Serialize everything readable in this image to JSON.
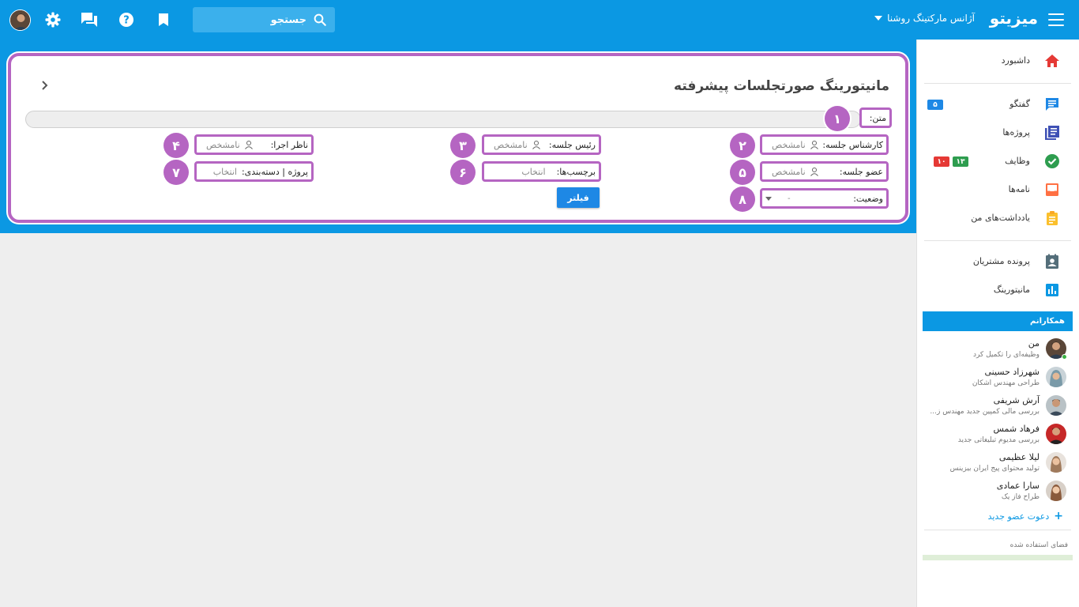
{
  "topbar": {
    "brand": "میزیتو",
    "org": "آژانس مارکتینگ روشنا",
    "search_placeholder": "جستجو",
    "icons": [
      "menu-icon",
      "search-icon",
      "bookmark-icon",
      "help-icon",
      "chat-icon",
      "settings-icon",
      "avatar"
    ]
  },
  "page": {
    "title": "مانیتورینگ صورتجلسات پیشرفته",
    "text_label": "متن:",
    "fields": {
      "expert": {
        "label": "کارشناس جلسه:",
        "value": "نامشخص"
      },
      "chair": {
        "label": "رئیس جلسه:",
        "value": "نامشخص"
      },
      "supervisor": {
        "label": "ناظر اجرا:",
        "value": "نامشخص"
      },
      "member": {
        "label": "عضو جلسه:",
        "value": "نامشخص"
      },
      "tags": {
        "label": "برچسب‌ها:",
        "value": "انتخاب"
      },
      "project": {
        "label": "پروژه | دسته‌بندی:",
        "value": "انتخاب"
      },
      "status": {
        "label": "وضعیت:",
        "value": "-"
      }
    },
    "badges": [
      "۱",
      "۲",
      "۳",
      "۴",
      "۵",
      "۶",
      "۷",
      "۸"
    ],
    "filter_button": "فیلتر"
  },
  "sidebar": {
    "items": [
      {
        "label": "داشبورد",
        "icon": "home-icon"
      },
      {
        "label": "گفتگو",
        "icon": "chat-icon",
        "badge": "۵"
      },
      {
        "label": "پروژه‌ها",
        "icon": "projects-icon"
      },
      {
        "label": "وظایف",
        "icon": "check-icon",
        "badges": [
          "۱۳",
          "۱۰"
        ]
      },
      {
        "label": "نامه‌ها",
        "icon": "inbox-icon"
      },
      {
        "label": "یادداشت‌های من",
        "icon": "notes-icon"
      },
      {
        "label": "پرونده مشتریان",
        "icon": "contacts-icon"
      },
      {
        "label": "مانیتورینگ",
        "icon": "chart-icon"
      }
    ],
    "team_header": "همکارانم",
    "members": [
      {
        "name": "من",
        "task": "وظیفه‌ای را تکمیل کرد"
      },
      {
        "name": "شهرزاد حسینی",
        "task": "طراحی مهندس اشکان"
      },
      {
        "name": "آرش شریفی",
        "task": "بررسی مالی کمپین جدید مهندس ز..."
      },
      {
        "name": "فرهاد شمس",
        "task": "بررسی مدیوم تبلیغاتی جدید"
      },
      {
        "name": "لیلا عظیمی",
        "task": "تولید محتوای پیج ایران بیزینس"
      },
      {
        "name": "سارا عمادی",
        "task": "طراح فاز یک"
      }
    ],
    "invite": "دعوت عضو جدید",
    "space_label": "فضای استفاده شده"
  },
  "colors": {
    "primary": "#0b98e3",
    "highlight": "#b565c2",
    "button": "#1e88e5"
  }
}
